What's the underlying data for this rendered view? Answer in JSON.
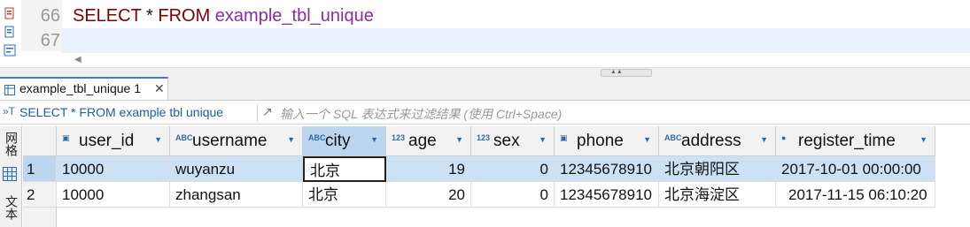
{
  "editor": {
    "lines": [
      {
        "number": "66",
        "kw1": "SELECT",
        "op": " * ",
        "kw2": "FROM",
        "table": " example_tbl_unique"
      },
      {
        "number": "67"
      }
    ],
    "left_tools": [
      "run-script-icon",
      "explain-icon",
      "format-icon"
    ],
    "scroll_arrow": "◀"
  },
  "results_tab": {
    "label": "example_tbl_unique 1",
    "close": "✕"
  },
  "filter": {
    "icon": "»T",
    "sql": "SELECT * FROM example  tbl  unique",
    "expand": "↗",
    "hint": "输入一个 SQL 表达式来过滤结果 (使用 Ctrl+Space)"
  },
  "side_tabs": {
    "grid": "网格",
    "text": "文本"
  },
  "grid": {
    "columns": [
      {
        "name": "user_id",
        "type": "key"
      },
      {
        "name": "username",
        "type": "ABC"
      },
      {
        "name": "city",
        "type": "ABC"
      },
      {
        "name": "age",
        "type": "123"
      },
      {
        "name": "sex",
        "type": "123"
      },
      {
        "name": "phone",
        "type": "key"
      },
      {
        "name": "address",
        "type": "ABC"
      },
      {
        "name": "register_time",
        "type": "clock"
      }
    ],
    "rows": [
      {
        "num": "1",
        "cells": [
          "10000",
          "wuyanzu",
          "北京",
          "19",
          "0",
          "12345678910",
          "北京朝阳区",
          "2017-10-01 00:00:00"
        ]
      },
      {
        "num": "2",
        "cells": [
          "10000",
          "zhangsan",
          "北京",
          "20",
          "0",
          "12345678910",
          "北京海淀区",
          "2017-11-15 06:10:20"
        ]
      }
    ]
  },
  "colors": {
    "keyword": "#7f0000",
    "identifier": "#8a2ca8",
    "selection": "#cde1f5",
    "header_selected": "#bcd6ef"
  }
}
